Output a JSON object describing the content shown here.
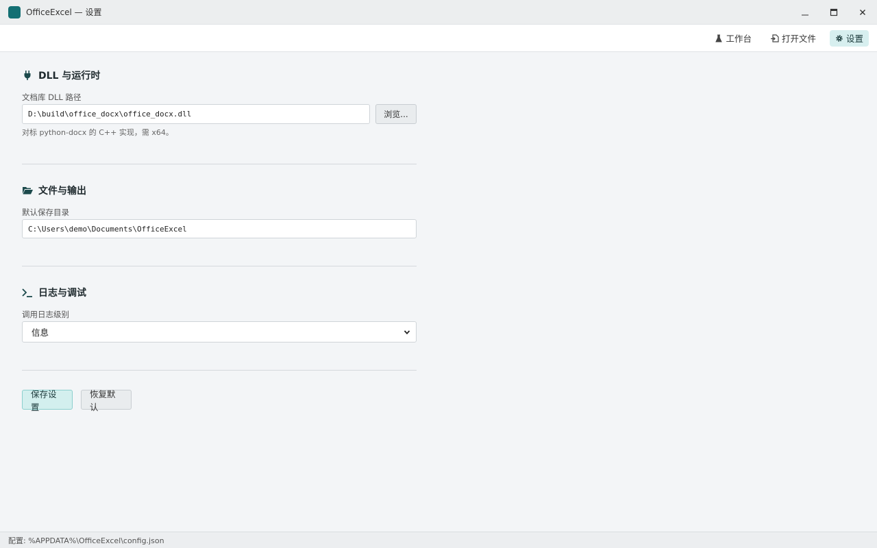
{
  "window": {
    "title": "OfficeExcel — 设置",
    "accent": "#136f73"
  },
  "toolbar": {
    "workbench": "工作台",
    "open_file": "打开文件",
    "settings": "设置"
  },
  "dll": {
    "title": "DLL 与运行时",
    "field_label": "文档库 DLL 路径",
    "path_value": "D:\\build\\office_docx\\office_docx.dll",
    "browse_label": "浏览...",
    "hint": "对标 python-docx 的 C++ 实现，需 x64。"
  },
  "files": {
    "title": "文件与输出",
    "field_label": "默认保存目录",
    "dir_value": "C:\\Users\\demo\\Documents\\OfficeExcel"
  },
  "logging": {
    "title": "日志与调试",
    "field_label": "调用日志级别",
    "selected": "信息"
  },
  "actions": {
    "save": "保存设置",
    "reset": "恢复默认"
  },
  "status": {
    "config_path": "配置: %APPDATA%\\OfficeExcel\\config.json"
  }
}
